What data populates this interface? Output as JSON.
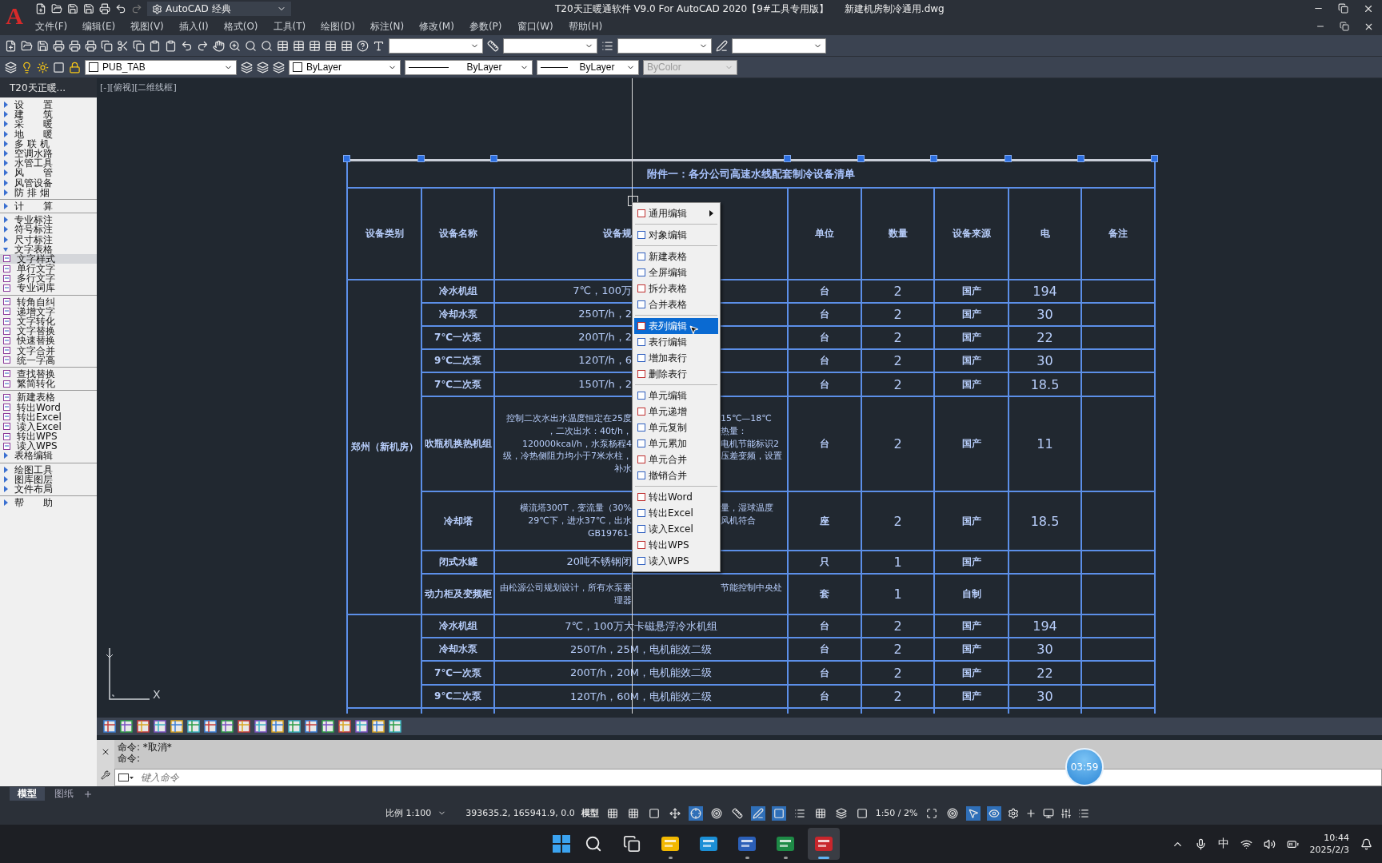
{
  "title_bar": {
    "app_logo": "A",
    "workspace": "AutoCAD 经典",
    "title": "T20天正暖通软件 V9.0 For AutoCAD 2020【9#工具专用版】",
    "file_name": "新建机房制冷通用.dwg"
  },
  "menu_bar": [
    "文件(F)",
    "编辑(E)",
    "视图(V)",
    "插入(I)",
    "格式(O)",
    "工具(T)",
    "绘图(D)",
    "标注(N)",
    "修改(M)",
    "参数(P)",
    "窗口(W)",
    "帮助(H)"
  ],
  "properties_bar": {
    "layer": "PUB_TAB",
    "color_control": "ByLayer",
    "linetype": "ByLayer",
    "lineweight": "ByLayer",
    "plot_style": "ByColor",
    "plot_style_disabled": true
  },
  "sidebar": {
    "title": "T20天正暖...",
    "items": [
      {
        "kind": "folder",
        "label": "设　　置",
        "expanded": false,
        "selected": false
      },
      {
        "kind": "folder",
        "label": "建　　筑",
        "expanded": false,
        "selected": false
      },
      {
        "kind": "folder",
        "label": "采　　暖",
        "expanded": false,
        "selected": false
      },
      {
        "kind": "folder",
        "label": "地　　暖",
        "expanded": false,
        "selected": false
      },
      {
        "kind": "folder",
        "label": "多 联 机",
        "expanded": false,
        "selected": false
      },
      {
        "kind": "folder",
        "label": "空调水路",
        "expanded": false,
        "selected": false
      },
      {
        "kind": "folder",
        "label": "水管工具",
        "expanded": false,
        "selected": false
      },
      {
        "kind": "folder",
        "label": "风　　管",
        "expanded": false,
        "selected": false
      },
      {
        "kind": "folder",
        "label": "风管设备",
        "expanded": false,
        "selected": false
      },
      {
        "kind": "folder",
        "label": "防 排 烟",
        "expanded": false,
        "selected": false
      },
      {
        "kind": "separator"
      },
      {
        "kind": "folder",
        "label": "计　　算",
        "expanded": false,
        "selected": false
      },
      {
        "kind": "separator"
      },
      {
        "kind": "folder",
        "label": "专业标注",
        "expanded": false,
        "selected": false
      },
      {
        "kind": "folder",
        "label": "符号标注",
        "expanded": false,
        "selected": false
      },
      {
        "kind": "folder",
        "label": "尺寸标注",
        "expanded": false,
        "selected": false
      },
      {
        "kind": "folder",
        "label": "文字表格",
        "expanded": true,
        "selected": false,
        "children": [
          {
            "kind": "command",
            "label": "文字样式",
            "selected": true
          },
          {
            "kind": "command",
            "label": "单行文字",
            "selected": false
          },
          {
            "kind": "command",
            "label": "多行文字",
            "selected": false
          },
          {
            "kind": "command",
            "label": "专业词库",
            "selected": false
          },
          {
            "kind": "separator"
          },
          {
            "kind": "command",
            "label": "转角自纠",
            "selected": false
          },
          {
            "kind": "command",
            "label": "递增文字",
            "selected": false
          },
          {
            "kind": "command",
            "label": "文字转化",
            "selected": false
          },
          {
            "kind": "command",
            "label": "文字替换",
            "selected": false
          },
          {
            "kind": "command",
            "label": "快速替换",
            "selected": false
          },
          {
            "kind": "command",
            "label": "文字合并",
            "selected": false
          },
          {
            "kind": "command",
            "label": "统一字高",
            "selected": false
          },
          {
            "kind": "separator"
          },
          {
            "kind": "command",
            "label": "查找替换",
            "selected": false
          },
          {
            "kind": "command",
            "label": "繁简转化",
            "selected": false
          },
          {
            "kind": "separator"
          },
          {
            "kind": "command",
            "label": "新建表格",
            "selected": false
          },
          {
            "kind": "command",
            "label": "转出Word",
            "selected": false
          },
          {
            "kind": "command",
            "label": "转出Excel",
            "selected": false
          },
          {
            "kind": "command",
            "label": "读入Excel",
            "selected": false
          },
          {
            "kind": "command",
            "label": "转出WPS",
            "selected": false
          },
          {
            "kind": "command",
            "label": "读入WPS",
            "selected": false
          },
          {
            "kind": "folder",
            "label": "表格编辑",
            "expanded": false,
            "selected": false
          }
        ]
      },
      {
        "kind": "separator"
      },
      {
        "kind": "folder",
        "label": "绘图工具",
        "expanded": false,
        "selected": false
      },
      {
        "kind": "folder",
        "label": "图库图层",
        "expanded": false,
        "selected": false
      },
      {
        "kind": "folder",
        "label": "文件布局",
        "expanded": false,
        "selected": false
      },
      {
        "kind": "separator"
      },
      {
        "kind": "folder",
        "label": "帮　　助",
        "expanded": false,
        "selected": false
      }
    ]
  },
  "viewport_label": "[-][俯视][二维线框]",
  "table": {
    "title": "附件一：各分公司高速水线配套制冷设备清单",
    "columns": [
      "设备类别",
      "设备名称",
      "设备规",
      "单位",
      "数量",
      "设备来源",
      "电",
      "备注"
    ],
    "groups": [
      {
        "category": "郑州（新机房）",
        "rows": [
          {
            "name": "冷水机组",
            "spec_left": [
              "7℃，100万"
            ],
            "unit": "台",
            "qty": "2",
            "source": "国产",
            "power": "194"
          },
          {
            "name": "冷却水泵",
            "spec_left": [
              "250T/h，2"
            ],
            "unit": "台",
            "qty": "2",
            "source": "国产",
            "power": "30"
          },
          {
            "name": "7℃一次泵",
            "spec_left": [
              "200T/h，2"
            ],
            "unit": "台",
            "qty": "2",
            "source": "国产",
            "power": "22"
          },
          {
            "name": "9℃二次泵",
            "spec_left": [
              "120T/h，6"
            ],
            "unit": "台",
            "qty": "2",
            "source": "国产",
            "power": "30"
          },
          {
            "name": "7℃二次泵",
            "spec_left": [
              "150T/h，2"
            ],
            "unit": "台",
            "qty": "2",
            "source": "国产",
            "power": "18.5"
          },
          {
            "name": "吹瓶机换热机组",
            "spec_left": [
              "控制二次水出水温度恒定在25度",
              "，二次出水：40t/h，",
              "120000kcal/h，水泵杨程4",
              "级，冷热侧阻力均小于7米水柱，",
              "补水"
            ],
            "spec_right": [
              "15℃—18℃",
              "热量：",
              "电机节能标识2",
              "压差变频，设置"
            ],
            "unit": "台",
            "qty": "2",
            "source": "国产",
            "power": "11"
          },
          {
            "name": "冷却塔",
            "spec_left": [
              "横流塔300T，变流量（30%",
              "29℃下，进水37℃，出水",
              "GB19761-"
            ],
            "spec_right": [
              "量，湿球温度",
              "风机符合"
            ],
            "unit": "座",
            "qty": "2",
            "source": "国产",
            "power": "18.5"
          },
          {
            "name": "闭式水罐",
            "spec_left": [
              "20吨不锈钢闭"
            ],
            "unit": "只",
            "qty": "1",
            "source": "国产"
          },
          {
            "name": "动力柜及变频柜",
            "spec_left": [
              "由松源公司规划设计，所有水泵要",
              "理器"
            ],
            "spec_right": [
              "节能控制中央处"
            ],
            "unit": "套",
            "qty": "1",
            "source": "自制"
          }
        ]
      },
      {
        "rows": [
          {
            "name": "冷水机组",
            "spec": "7℃，100万大卡磁悬浮冷水机组",
            "unit": "台",
            "qty": "2",
            "source": "国产",
            "power": "194"
          },
          {
            "name": "冷却水泵",
            "spec": "250T/h，25M，电机能效二级",
            "unit": "台",
            "qty": "2",
            "source": "国产",
            "power": "30"
          },
          {
            "name": "7℃一次泵",
            "spec": "200T/h，20M，电机能效二级",
            "unit": "台",
            "qty": "2",
            "source": "国产",
            "power": "22"
          },
          {
            "name": "9℃二次泵",
            "spec": "120T/h，60M，电机能效二级",
            "unit": "台",
            "qty": "2",
            "source": "国产",
            "power": "30"
          }
        ]
      }
    ]
  },
  "context_menu": [
    {
      "kind": "item",
      "label": "通用编辑",
      "submenu": true,
      "selected": false
    },
    {
      "kind": "separator"
    },
    {
      "kind": "item",
      "label": "对象编辑",
      "submenu": false,
      "selected": false
    },
    {
      "kind": "separator"
    },
    {
      "kind": "item",
      "label": "新建表格",
      "submenu": false,
      "selected": false
    },
    {
      "kind": "item",
      "label": "全屏编辑",
      "submenu": false,
      "selected": false
    },
    {
      "kind": "item",
      "label": "拆分表格",
      "submenu": false,
      "selected": false
    },
    {
      "kind": "item",
      "label": "合并表格",
      "submenu": false,
      "selected": false
    },
    {
      "kind": "separator"
    },
    {
      "kind": "item",
      "label": "表列编辑",
      "submenu": false,
      "selected": true
    },
    {
      "kind": "item",
      "label": "表行编辑",
      "submenu": false,
      "selected": false
    },
    {
      "kind": "item",
      "label": "增加表行",
      "submenu": false,
      "selected": false
    },
    {
      "kind": "item",
      "label": "删除表行",
      "submenu": false,
      "selected": false
    },
    {
      "kind": "separator"
    },
    {
      "kind": "item",
      "label": "单元编辑",
      "submenu": false,
      "selected": false
    },
    {
      "kind": "item",
      "label": "单元递增",
      "submenu": false,
      "selected": false
    },
    {
      "kind": "item",
      "label": "单元复制",
      "submenu": false,
      "selected": false
    },
    {
      "kind": "item",
      "label": "单元累加",
      "submenu": false,
      "selected": false
    },
    {
      "kind": "item",
      "label": "单元合并",
      "submenu": false,
      "selected": false
    },
    {
      "kind": "item",
      "label": "撤销合并",
      "submenu": false,
      "selected": false
    },
    {
      "kind": "separator"
    },
    {
      "kind": "item",
      "label": "转出Word",
      "submenu": false,
      "selected": false
    },
    {
      "kind": "item",
      "label": "转出Excel",
      "submenu": false,
      "selected": false
    },
    {
      "kind": "item",
      "label": "读入Excel",
      "submenu": false,
      "selected": false
    },
    {
      "kind": "item",
      "label": "转出WPS",
      "submenu": false,
      "selected": false
    },
    {
      "kind": "item",
      "label": "读入WPS",
      "submenu": false,
      "selected": false
    }
  ],
  "ucs": {
    "x_label": "X"
  },
  "command": {
    "history": [
      "命令: *取消*",
      "命令:"
    ],
    "placeholder": "键入命令"
  },
  "timer": "03:59",
  "layout_tabs": [
    {
      "label": "模型",
      "selected": true
    },
    {
      "label": "图纸",
      "selected": false
    }
  ],
  "status_bar": {
    "scale": "比例 1:100",
    "coordinates": "393635.2, 165941.9, 0.0",
    "space": "模型",
    "annotation_scale": "1:50 / 2%",
    "toggles": [
      {
        "on": false
      },
      {
        "on": false
      },
      {
        "on": false
      },
      {
        "on": false
      },
      {
        "on": true
      },
      {
        "on": false
      },
      {
        "on": false
      },
      {
        "on": true
      },
      {
        "on": true
      },
      {
        "on": false
      },
      {
        "on": false
      },
      {
        "on": false
      },
      {
        "on": false
      },
      {
        "on": false
      },
      {
        "on": false
      },
      {
        "on": true
      },
      {
        "on": true
      }
    ]
  },
  "taskbar": {
    "ime": "中",
    "time": "10:44",
    "date": "2025/2/3",
    "apps": [
      {
        "running": true,
        "active": false
      },
      {
        "running": false,
        "active": false
      },
      {
        "running": true,
        "active": false
      },
      {
        "running": true,
        "active": false
      },
      {
        "running": true,
        "active": true
      }
    ]
  }
}
